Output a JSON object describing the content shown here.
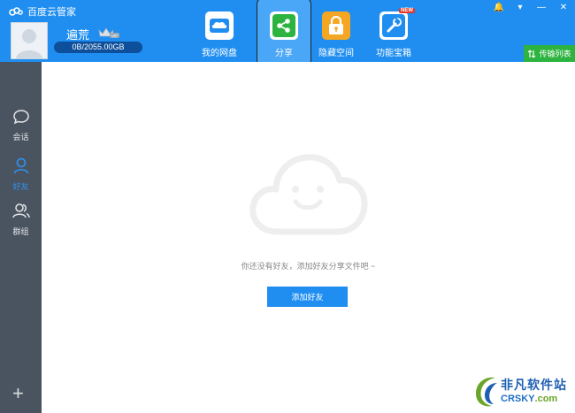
{
  "app": {
    "title": "百度云管家"
  },
  "user": {
    "name": "遍荒",
    "vip_label": "VIP",
    "quota": "0B/2055.00GB"
  },
  "window_controls": {
    "pin": "🔔",
    "menu": "▾",
    "minimize": "—",
    "close": "✕"
  },
  "nav": [
    {
      "label": "我的网盘",
      "icon": "cloud-drive-icon",
      "color": "#ffffff"
    },
    {
      "label": "分享",
      "icon": "share-icon",
      "color": "#2db340"
    },
    {
      "label": "隐藏空间",
      "icon": "lock-icon",
      "color": "#f5a623"
    },
    {
      "label": "功能宝箱",
      "icon": "toolbox-icon",
      "color": "#ffffff",
      "badge": "NEW"
    }
  ],
  "transfer": {
    "label": "传输列表"
  },
  "sidebar": [
    {
      "label": "会话",
      "icon": "chat-bubble-icon"
    },
    {
      "label": "好友",
      "icon": "person-icon",
      "active": true
    },
    {
      "label": "群组",
      "icon": "group-icon"
    }
  ],
  "sidebar_add": "+",
  "content": {
    "empty_message": "你还没有好友，添加好友分享文件吧 ~",
    "add_friend_label": "添加好友"
  },
  "watermark": {
    "line1": "非凡软件站",
    "line2_main": "CRSKY",
    "line2_suffix": ".com"
  }
}
